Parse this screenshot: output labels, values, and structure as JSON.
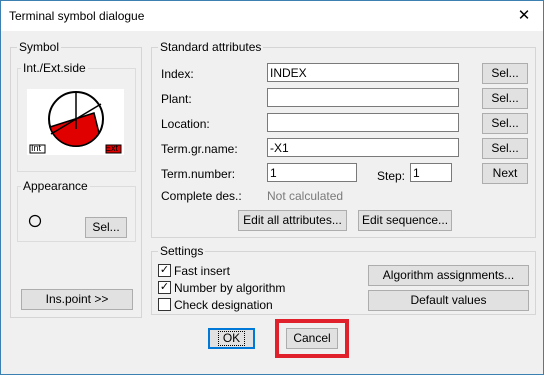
{
  "window": {
    "title": "Terminal symbol dialogue",
    "close_glyph": "✕"
  },
  "symbol": {
    "group_label": "Symbol",
    "side_label": "Int./Ext.side",
    "int_label": "Int",
    "ext_label": "Ext",
    "appearance_label": "Appearance",
    "sel_button": "Sel...",
    "ins_point_button": "Ins.point >>"
  },
  "standard": {
    "group_label": "Standard attributes",
    "index_label": "Index:",
    "index_value": "INDEX",
    "plant_label": "Plant:",
    "plant_value": "",
    "location_label": "Location:",
    "location_value": "",
    "termgr_label": "Term.gr.name:",
    "termgr_value": "-X1",
    "termnum_label": "Term.number:",
    "termnum_value": "1",
    "step_label": "Step:",
    "step_value": "1",
    "complete_label": "Complete des.:",
    "complete_value": "Not calculated",
    "sel_button": "Sel...",
    "next_button": "Next",
    "edit_all_button": "Edit all attributes...",
    "edit_seq_button": "Edit sequence..."
  },
  "settings": {
    "group_label": "Settings",
    "fast_insert_label": "Fast insert",
    "fast_insert_checked": true,
    "number_algo_label": "Number by algorithm",
    "number_algo_checked": true,
    "check_desig_label": "Check designation",
    "check_desig_checked": false,
    "algo_button": "Algorithm assignments...",
    "default_button": "Default values"
  },
  "footer": {
    "ok_button": "OK",
    "cancel_button": "Cancel"
  },
  "colors": {
    "symbol_red": "#e00000",
    "highlight": "#e0202a",
    "accent": "#0078d7"
  }
}
